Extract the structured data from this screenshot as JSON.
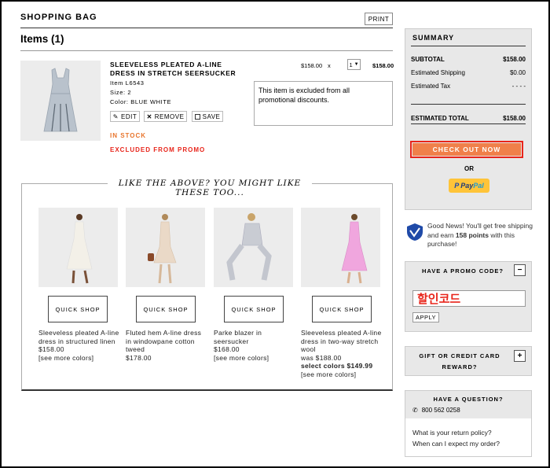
{
  "header": {
    "title": "SHOPPING BAG",
    "print_label": "PRINT",
    "items_heading": "Items (1)"
  },
  "item": {
    "name": "SLEEVELESS PLEATED A-LINE DRESS IN STRETCH SEERSUCKER",
    "item_no": "Item L6543",
    "size": "Size: 2",
    "color": "Color: BLUE WHITE",
    "price": "$158.00",
    "times": "x",
    "qty": "1",
    "total": "$158.00",
    "note": "This item is excluded from all promotional discounts.",
    "edit_label": "EDIT",
    "remove_label": "REMOVE",
    "save_label": "SAVE",
    "stock": "IN STOCK",
    "promo_excluded": "EXCLUDED FROM PROMO"
  },
  "recs": {
    "heading": "LIKE THE ABOVE? YOU MIGHT LIKE THESE TOO...",
    "quick_shop": "QUICK SHOP",
    "products": [
      {
        "name": "Sleeveless pleated A-line dress in structured linen",
        "price": "$158.00",
        "more": "[see more colors]"
      },
      {
        "name": "Fluted hem A-line dress in windowpane cotton tweed",
        "price": "$178.00"
      },
      {
        "name": "Parke blazer in seersucker",
        "price": "$168.00",
        "more": "[see more colors]"
      },
      {
        "name": "Sleeveless pleated A-line dress in two-way stretch wool",
        "was": "was $188.00",
        "sale": "select colors $149.99",
        "more": "[see more colors]"
      }
    ]
  },
  "summary": {
    "title": "SUMMARY",
    "subtotal_label": "SUBTOTAL",
    "subtotal": "$158.00",
    "shipping_label": "Estimated Shipping",
    "shipping": "$0.00",
    "tax_label": "Estimated Tax",
    "tax": "- - - -",
    "total_label": "ESTIMATED TOTAL",
    "total": "$158.00",
    "checkout_label": "CHECK OUT NOW",
    "or_label": "OR",
    "paypal_pay": "Pay",
    "paypal_pal": "Pal"
  },
  "points": {
    "text_before": "Good News! You'll get free shipping and earn ",
    "points": "158 points",
    "text_after": " with this purchase!"
  },
  "promo": {
    "title": "HAVE A PROMO CODE?",
    "toggle": "−",
    "value": "할인코드",
    "apply_label": "APPLY"
  },
  "gift": {
    "title": "GIFT OR CREDIT CARD REWARD?",
    "toggle": "+"
  },
  "help": {
    "title": "HAVE A QUESTION?",
    "phone": "800 562 0258",
    "faq1": "What is your return policy?",
    "faq2": "When can I expect my order?"
  },
  "colors": {
    "checkout": "#f0804a",
    "stock": "#e8742b",
    "promo_red": "#e8251b",
    "paypal_yellow": "#ffc439",
    "points_blue": "#1f4aa8"
  }
}
